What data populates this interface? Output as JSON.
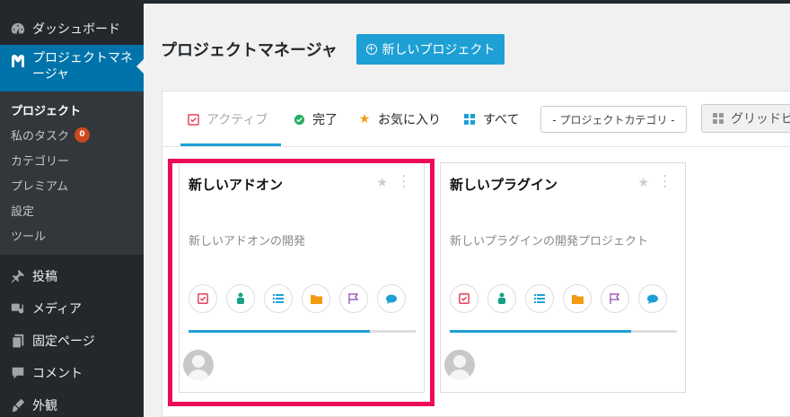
{
  "sidebar": {
    "dashboard": "ダッシュボード",
    "active_label_line1": "プロジェクトマネ",
    "active_label_line2": "ージャ",
    "submenu": [
      {
        "label": "プロジェクト"
      },
      {
        "label": "私のタスク",
        "badge": "0"
      },
      {
        "label": "カテゴリー"
      },
      {
        "label": "プレミアム"
      },
      {
        "label": "設定"
      },
      {
        "label": "ツール"
      }
    ],
    "posts": "投稿",
    "media": "メディア",
    "pages": "固定ページ",
    "comments": "コメント",
    "appearance": "外観"
  },
  "header": {
    "title": "プロジェクトマネージャ",
    "new_button": "新しいプロジェクト"
  },
  "tabs": {
    "active": "アクティブ",
    "completed": "完了",
    "favorites": "お気に入り",
    "all": "すべて",
    "category_select": "- プロジェクトカテゴリ -",
    "grid_view": "グリッドビ"
  },
  "projects": [
    {
      "title": "新しいアドオン",
      "description": "新しいアドオンの開発",
      "progress": 0.8
    },
    {
      "title": "新しいプラグイン",
      "description": "新しいプラグインの開発プロジェクト",
      "progress": 0.8
    }
  ],
  "colors": {
    "sidebar": "#23282d",
    "accent": "#0073aa",
    "button": "#1ea0d5",
    "highlight": "#ec0a5a"
  }
}
